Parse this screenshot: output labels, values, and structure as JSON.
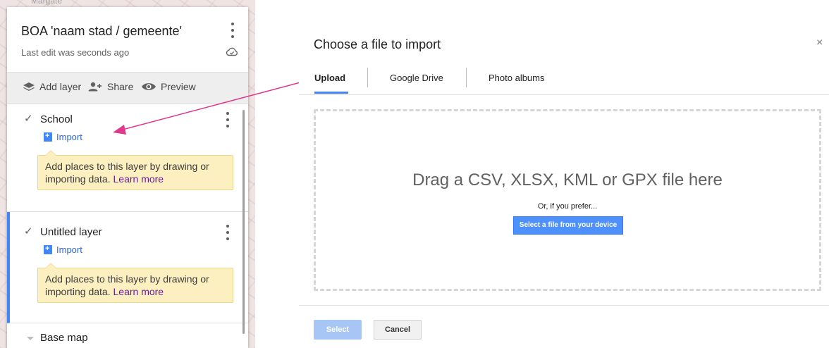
{
  "map_background": {
    "place_label": "Margate"
  },
  "panel": {
    "title": "BOA 'naam stad / gemeente'",
    "last_edit": "Last edit was seconds ago",
    "toolbar": {
      "add_layer": "Add layer",
      "share": "Share",
      "preview": "Preview"
    },
    "layers": [
      {
        "name": "School",
        "checked": true,
        "import_label": "Import",
        "tip_text": "Add places to this layer by drawing or importing data.",
        "tip_link": "Learn more"
      },
      {
        "name": "Untitled layer",
        "checked": true,
        "import_label": "Import",
        "tip_text": "Add places to this layer by drawing or importing data.",
        "tip_link": "Learn more"
      }
    ],
    "base_map": "Base map"
  },
  "dialog": {
    "title": "Choose a file to import",
    "close": "×",
    "tabs": [
      {
        "label": "Upload",
        "selected": true
      },
      {
        "label": "Google Drive",
        "selected": false
      },
      {
        "label": "Photo albums",
        "selected": false
      }
    ],
    "drop_text": "Drag a CSV, XLSX, KML or GPX file here",
    "prefer_text": "Or, if you prefer...",
    "select_device_button": "Select a file from your device",
    "footer": {
      "select_button": "Select",
      "cancel_button": "Cancel"
    }
  },
  "colors": {
    "accent": "#4285f4",
    "link": "#3367d6",
    "learn_more": "#6a1b9a",
    "tip_bg": "#fcf0c0",
    "arrow": "#e0388a"
  }
}
